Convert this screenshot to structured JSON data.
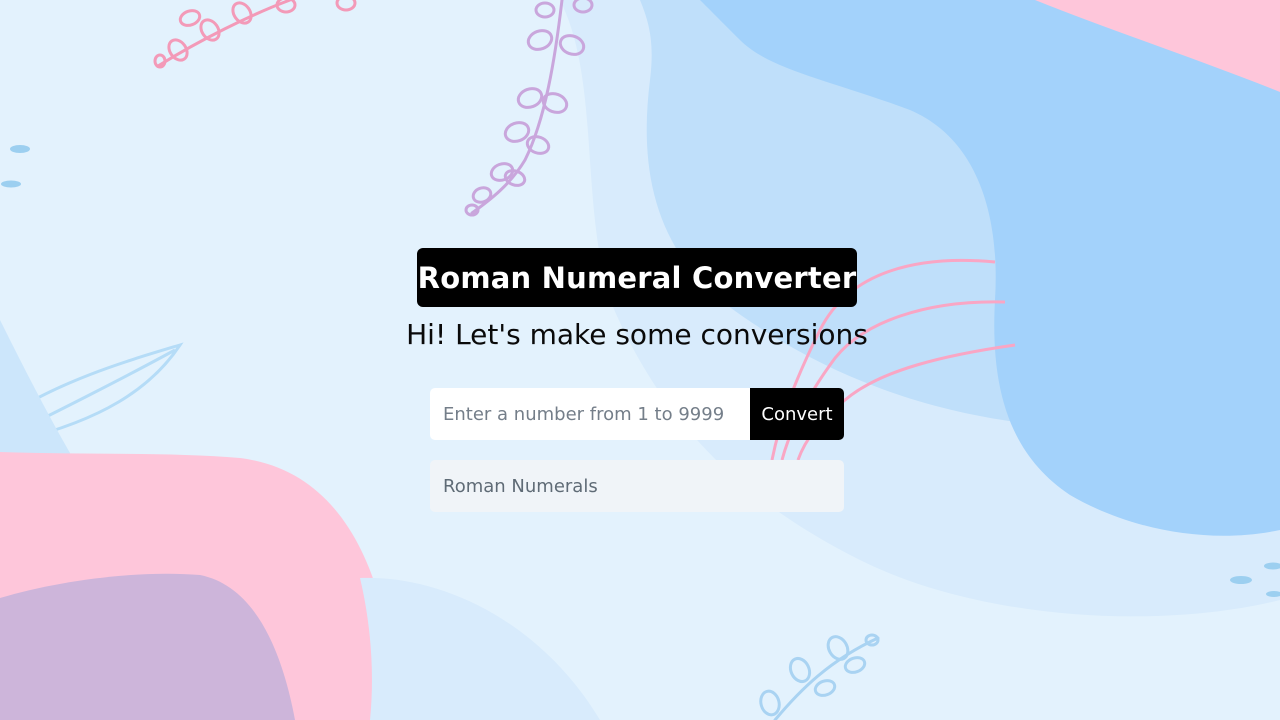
{
  "header": {
    "title": "Roman Numeral Converter",
    "subtitle": "Hi! Let's make some conversions"
  },
  "converter": {
    "input_placeholder": "Enter a number from 1 to 9999",
    "input_value": "",
    "button_label": "Convert",
    "output_text": "Roman Numerals"
  },
  "colors": {
    "background": "#e3f2fd",
    "blob_blue": "#a3d2fb",
    "blob_light_blue": "#bfdffa",
    "blob_pink": "#fec6da",
    "blob_purple": "#cdb5da",
    "title_background": "#000000",
    "button_background": "#000000",
    "output_background": "#f0f4f8"
  },
  "decorations": [
    "pink-vine-icon",
    "purple-vine-icon",
    "pink-curved-lines",
    "blue-leaf-outline",
    "blue-vine-icon",
    "blue-dots"
  ]
}
